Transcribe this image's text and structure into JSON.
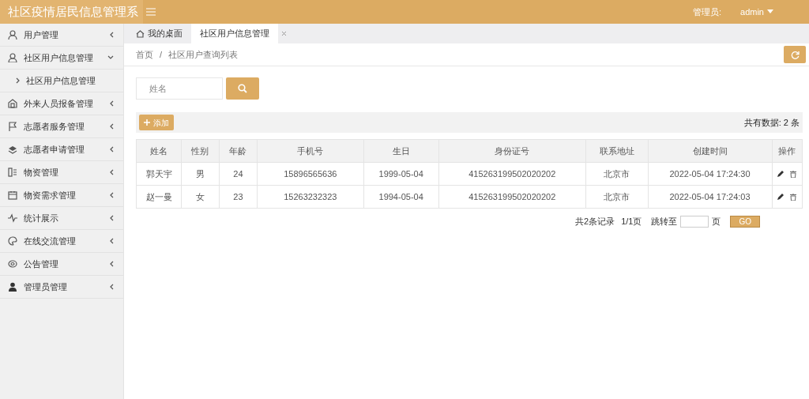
{
  "header": {
    "title": "社区疫情居民信息管理系",
    "user_label": "管理员:",
    "user_name": "admin"
  },
  "sidebar": {
    "items": [
      {
        "label": "用户管理",
        "expanded": false
      },
      {
        "label": "社区用户信息管理",
        "expanded": true,
        "children": [
          {
            "label": "社区用户信息管理"
          }
        ]
      },
      {
        "label": "外来人员报备管理",
        "expanded": false
      },
      {
        "label": "志愿者服务管理",
        "expanded": false
      },
      {
        "label": "志愿者申请管理",
        "expanded": false
      },
      {
        "label": "物资管理",
        "expanded": false
      },
      {
        "label": "物资需求管理",
        "expanded": false
      },
      {
        "label": "统计展示",
        "expanded": false
      },
      {
        "label": "在线交流管理",
        "expanded": false
      },
      {
        "label": "公告管理",
        "expanded": false
      },
      {
        "label": "管理员管理",
        "expanded": false
      }
    ]
  },
  "tabs": [
    {
      "label": "我的桌面",
      "selected": false,
      "closable": false
    },
    {
      "label": "社区用户信息管理",
      "selected": true,
      "closable": true
    }
  ],
  "breadcrumb": {
    "items": [
      "首页",
      "社区用户查询列表"
    ],
    "separator": "/"
  },
  "search": {
    "placeholder": "姓名"
  },
  "toolbar": {
    "add_label": "添加",
    "total": "共有数据: 2 条"
  },
  "table": {
    "columns": [
      "姓名",
      "性别",
      "年龄",
      "手机号",
      "生日",
      "身份证号",
      "联系地址",
      "创建时间",
      "操作"
    ],
    "rows": [
      [
        "郭天宇",
        "男",
        "24",
        "15896565636",
        "1999-05-04",
        "415263199502020202",
        "北京市",
        "2022-05-04 17:24:30"
      ],
      [
        "赵一曼",
        "女",
        "23",
        "15263232323",
        "1994-05-04",
        "415263199502020202",
        "北京市",
        "2022-05-04 17:24:03"
      ]
    ]
  },
  "pagination": {
    "summary": "共2条记录",
    "pages": "1/1页",
    "jump_label": "跳转至",
    "page_suffix": "页",
    "go_label": "GO"
  }
}
